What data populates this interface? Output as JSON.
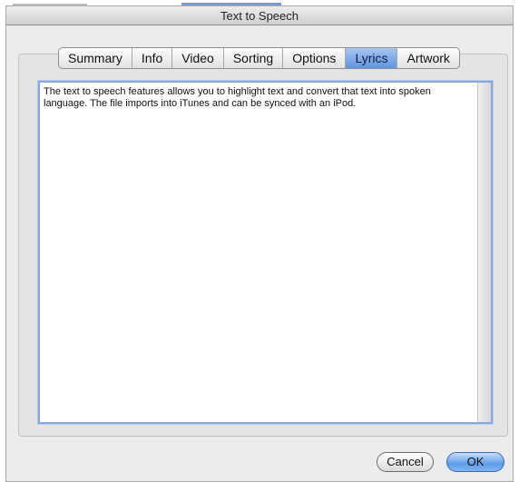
{
  "window": {
    "title": "Text to Speech"
  },
  "tabs": [
    {
      "label": "Summary",
      "selected": false
    },
    {
      "label": "Info",
      "selected": false
    },
    {
      "label": "Video",
      "selected": false
    },
    {
      "label": "Sorting",
      "selected": false
    },
    {
      "label": "Options",
      "selected": false
    },
    {
      "label": "Lyrics",
      "selected": true
    },
    {
      "label": "Artwork",
      "selected": false
    }
  ],
  "lyrics": {
    "text": "The text to speech features allows you to highlight text and convert that text into spoken language. The file imports into iTunes and can be synced with an iPod."
  },
  "buttons": {
    "cancel_label": "Cancel",
    "ok_label": "OK"
  },
  "colors": {
    "selected_tab": "#6f9fe4",
    "default_button": "#5e9de9",
    "focus_ring": "#86a8de"
  }
}
